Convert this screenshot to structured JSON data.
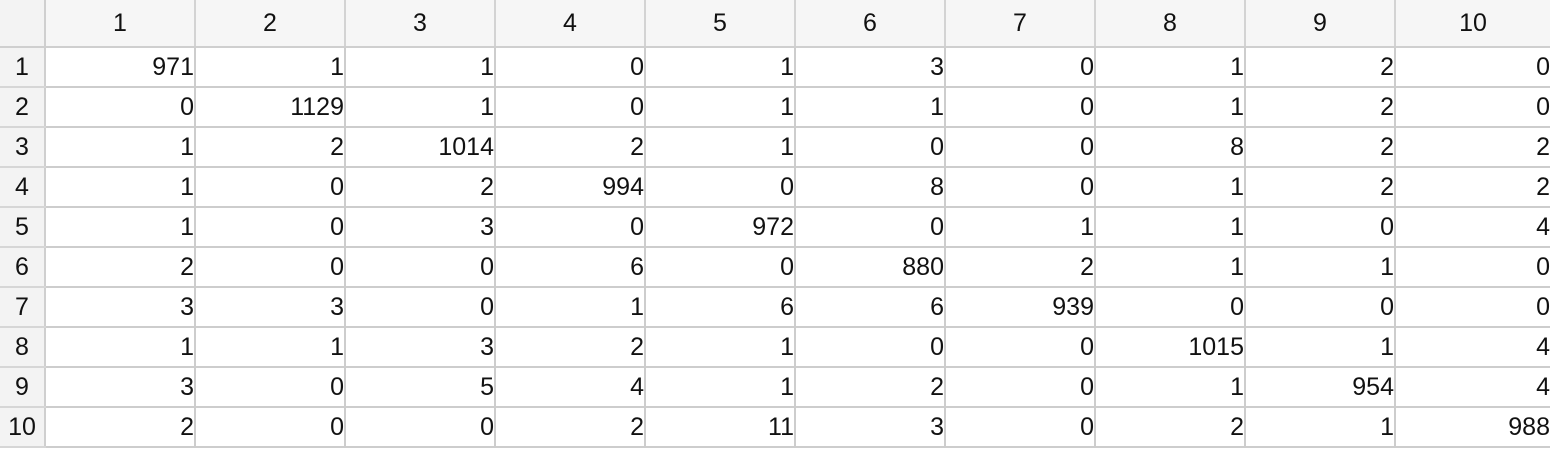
{
  "columns": [
    "1",
    "2",
    "3",
    "4",
    "5",
    "6",
    "7",
    "8",
    "9",
    "10"
  ],
  "rows": [
    {
      "label": "1",
      "cells": [
        "971",
        "1",
        "1",
        "0",
        "1",
        "3",
        "0",
        "1",
        "2",
        "0"
      ]
    },
    {
      "label": "2",
      "cells": [
        "0",
        "1129",
        "1",
        "0",
        "1",
        "1",
        "0",
        "1",
        "2",
        "0"
      ]
    },
    {
      "label": "3",
      "cells": [
        "1",
        "2",
        "1014",
        "2",
        "1",
        "0",
        "0",
        "8",
        "2",
        "2"
      ]
    },
    {
      "label": "4",
      "cells": [
        "1",
        "0",
        "2",
        "994",
        "0",
        "8",
        "0",
        "1",
        "2",
        "2"
      ]
    },
    {
      "label": "5",
      "cells": [
        "1",
        "0",
        "3",
        "0",
        "972",
        "0",
        "1",
        "1",
        "0",
        "4"
      ]
    },
    {
      "label": "6",
      "cells": [
        "2",
        "0",
        "0",
        "6",
        "0",
        "880",
        "2",
        "1",
        "1",
        "0"
      ]
    },
    {
      "label": "7",
      "cells": [
        "3",
        "3",
        "0",
        "1",
        "6",
        "6",
        "939",
        "0",
        "0",
        "0"
      ]
    },
    {
      "label": "8",
      "cells": [
        "1",
        "1",
        "3",
        "2",
        "1",
        "0",
        "0",
        "1015",
        "1",
        "4"
      ]
    },
    {
      "label": "9",
      "cells": [
        "3",
        "0",
        "5",
        "4",
        "1",
        "2",
        "0",
        "1",
        "954",
        "4"
      ]
    },
    {
      "label": "10",
      "cells": [
        "2",
        "0",
        "0",
        "2",
        "11",
        "3",
        "0",
        "2",
        "1",
        "988"
      ]
    }
  ]
}
